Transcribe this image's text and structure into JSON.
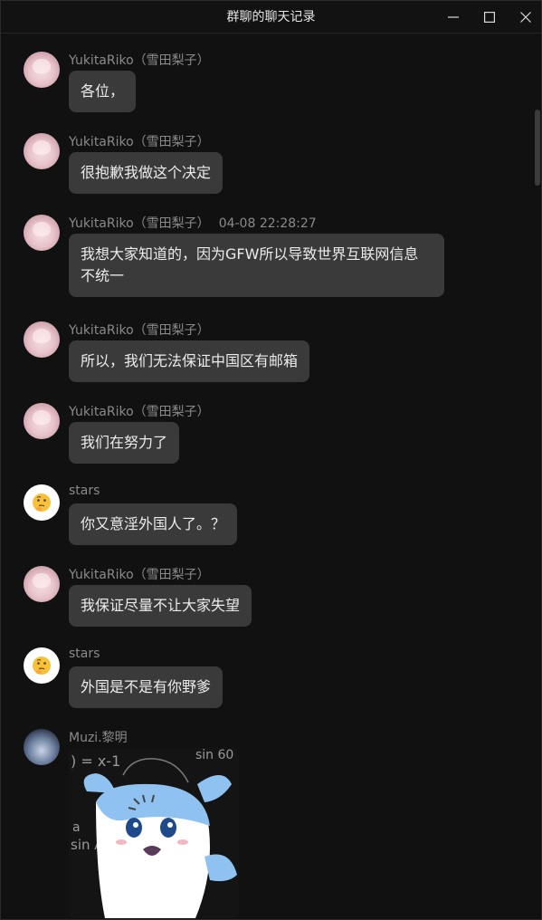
{
  "window": {
    "title": "群聊的聊天记录"
  },
  "messages": [
    {
      "sender": "YukitaRiko（雪田梨子）",
      "time": "",
      "text": "各位，"
    },
    {
      "sender": "YukitaRiko（雪田梨子）",
      "time": "",
      "text": "很抱歉我做这个决定"
    },
    {
      "sender": "YukitaRiko（雪田梨子）",
      "time": "04-08 22:28:27",
      "text": "我想大家知道的，因为GFW所以导致世界互联网信息不统一"
    },
    {
      "sender": "YukitaRiko（雪田梨子）",
      "time": "",
      "text": "所以，我们无法保证中国区有邮箱"
    },
    {
      "sender": "YukitaRiko（雪田梨子）",
      "time": "",
      "text": "我们在努力了"
    },
    {
      "sender": "stars",
      "time": "",
      "text": "你又意淫外国人了。？"
    },
    {
      "sender": "YukitaRiko（雪田梨子）",
      "time": "",
      "text": "我保证尽量不让大家失望"
    },
    {
      "sender": "stars",
      "time": "",
      "text": "外国是不是有你野爹"
    },
    {
      "sender": "Muzi.黎明",
      "time": "",
      "text": "",
      "image": "cartoon-sticker"
    }
  ],
  "sticker_text": {
    "line1": ") = x-1",
    "line2": "sin 60",
    "line3": "sin A",
    "line4": "a"
  },
  "colors": {
    "background": "#111111",
    "bubble": "#3a3a3a",
    "name": "#8a8a8a"
  },
  "icons": {
    "minimize": "minimize-icon",
    "maximize": "maximize-icon",
    "close": "close-icon",
    "stars_avatar": "thinking-face-icon"
  }
}
